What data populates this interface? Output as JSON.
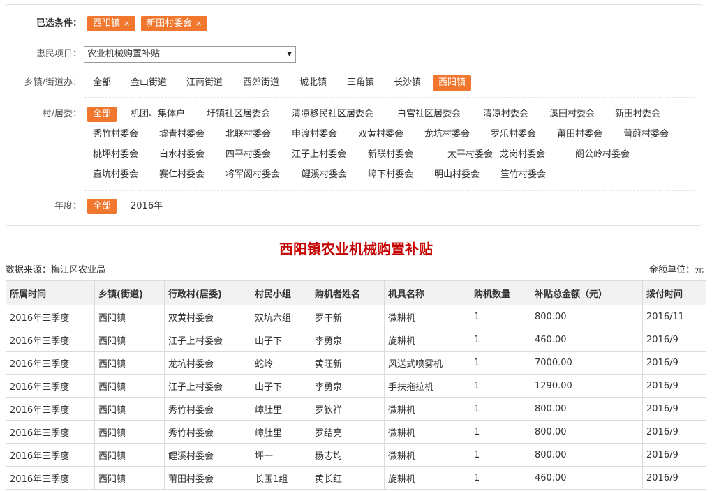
{
  "selected": {
    "label": "已选条件：",
    "chips": [
      {
        "text": "西阳镇",
        "close": "×"
      },
      {
        "text": "新田村委会",
        "close": "×"
      }
    ]
  },
  "project": {
    "label": "惠民项目：",
    "value": "农业机械购置补贴",
    "arrow": "▼"
  },
  "town": {
    "label": "乡镇/街道办：",
    "options": [
      "全部",
      "金山街道",
      "江南街道",
      "西郊街道",
      "城北镇",
      "三角镇",
      "长沙镇",
      "西阳镇"
    ],
    "selected": "西阳镇"
  },
  "village": {
    "label": "村/居委：",
    "selected": "全部",
    "rows": [
      [
        "全部",
        "机团、集体户",
        "圩镇社区居委会",
        "清凉移民社区居委会",
        "白宫社区居委会",
        "清凉村委会",
        "溪田村委会",
        "新田村委会"
      ],
      [
        "秀竹村委会",
        "墟青村委会",
        "北联村委会",
        "申渡村委会",
        "双黄村委会",
        "龙坑村委会",
        "罗乐村委会",
        "莆田村委会",
        "莆蔚村委会"
      ],
      [
        "桃坪村委会",
        "白水村委会",
        "四平村委会",
        "江子上村委会",
        "新联村委会",
        "太平村委会",
        "龙岗村委会",
        "阁公岭村委会"
      ],
      [
        "直坑村委会",
        "赛仁村委会",
        "将军阁村委会",
        "鲤溪村委会",
        "嶂下村委会",
        "明山村委会",
        "笙竹村委会"
      ]
    ]
  },
  "year": {
    "label": "年度：",
    "options": [
      "全部",
      "2016年"
    ],
    "selected": "全部"
  },
  "report": {
    "title": "西阳镇农业机械购置补贴",
    "source": "数据来源：梅江区农业局",
    "unit": "金额单位：元"
  },
  "table": {
    "headers": [
      "所属时间",
      "乡镇(街道)",
      "行政村(居委)",
      "村民小组",
      "购机者姓名",
      "机具名称",
      "购机数量",
      "补贴总金额（元）",
      "拨付时间"
    ],
    "rows": [
      [
        "2016年三季度",
        "西阳镇",
        "双黄村委会",
        "双坑六组",
        "罗干新",
        "微耕机",
        "1",
        "800.00",
        "2016/11"
      ],
      [
        "2016年三季度",
        "西阳镇",
        "江子上村委会",
        "山子下",
        "李勇泉",
        "旋耕机",
        "1",
        "460.00",
        "2016/9"
      ],
      [
        "2016年三季度",
        "西阳镇",
        "龙坑村委会",
        "蛇岭",
        "黄旺新",
        "风送式喷雾机",
        "1",
        "7000.00",
        "2016/9"
      ],
      [
        "2016年三季度",
        "西阳镇",
        "江子上村委会",
        "山子下",
        "李勇泉",
        "手扶拖拉机",
        "1",
        "1290.00",
        "2016/9"
      ],
      [
        "2016年三季度",
        "西阳镇",
        "秀竹村委会",
        "嶂肚里",
        "罗钦祥",
        "微耕机",
        "1",
        "800.00",
        "2016/9"
      ],
      [
        "2016年三季度",
        "西阳镇",
        "秀竹村委会",
        "嶂肚里",
        "罗结亮",
        "微耕机",
        "1",
        "800.00",
        "2016/9"
      ],
      [
        "2016年三季度",
        "西阳镇",
        "鲤溪村委会",
        "坪一",
        "杨志均",
        "微耕机",
        "1",
        "800.00",
        "2016/9"
      ],
      [
        "2016年三季度",
        "西阳镇",
        "莆田村委会",
        "长围1组",
        "黄长红",
        "旋耕机",
        "1",
        "460.00",
        "2016/9"
      ]
    ]
  }
}
